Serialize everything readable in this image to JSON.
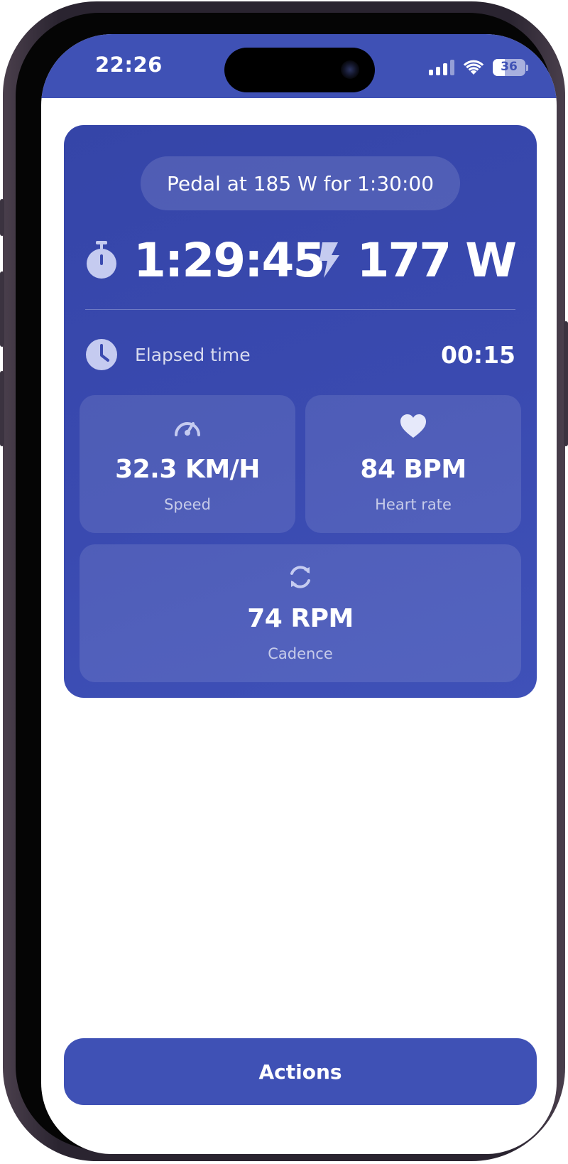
{
  "status_bar": {
    "time": "22:26",
    "battery_level": "36",
    "battery_fraction": 0.36
  },
  "workout": {
    "goal_text": "Pedal at 185 W for 1:30:00",
    "remaining_time": "1:29:45",
    "current_power": "177 W",
    "elapsed_label": "Elapsed time",
    "elapsed_value": "00:15",
    "metrics": [
      {
        "icon": "speedometer-icon",
        "value": "32.3 KM/H",
        "label": "Speed"
      },
      {
        "icon": "heart-icon",
        "value": "84 BPM",
        "label": "Heart rate"
      },
      {
        "icon": "refresh-icon",
        "value": "74 RPM",
        "label": "Cadence"
      }
    ]
  },
  "actions": {
    "label": "Actions"
  },
  "colors": {
    "accent": "#3f51b5",
    "card_background": "#3a4ab0",
    "text_primary": "#ffffff"
  }
}
